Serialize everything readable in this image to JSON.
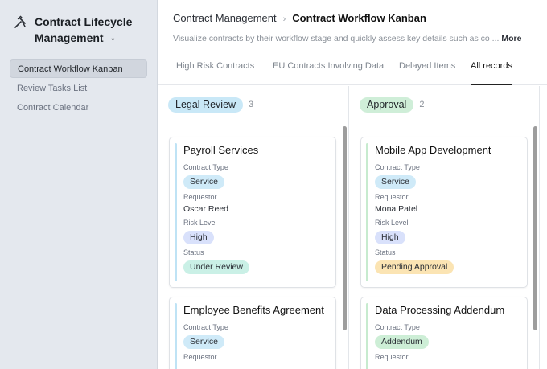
{
  "app": {
    "title_line1": "Contract Lifecycle",
    "title_line2": "Management",
    "icon": "tools-icon"
  },
  "sidebar": {
    "items": [
      {
        "label": "Contract Workflow Kanban",
        "active": true
      },
      {
        "label": "Review Tasks List",
        "active": false
      },
      {
        "label": "Contract Calendar",
        "active": false
      }
    ]
  },
  "breadcrumb": {
    "parent": "Contract Management",
    "separator": "›",
    "current": "Contract Workflow Kanban"
  },
  "description": {
    "text": "Visualize contracts by their workflow stage and quickly assess key details such as co ...",
    "more": "More"
  },
  "tabs": [
    {
      "label": "High Risk Contracts",
      "active": false
    },
    {
      "label": "EU Contracts Involving Data",
      "active": false
    },
    {
      "label": "Delayed Items",
      "active": false
    },
    {
      "label": "All records",
      "active": true
    }
  ],
  "columns": [
    {
      "name": "Legal Review",
      "count": "3",
      "pill_color": "#c9e8f7",
      "bar_color": "#bfe3f5",
      "cards": [
        {
          "title": "Payroll Services",
          "contract_type_label": "Contract Type",
          "contract_type": "Service",
          "requestor_label": "Requestor",
          "requestor": "Oscar Reed",
          "risk_label": "Risk Level",
          "risk": "High",
          "status_label": "Status",
          "status": "Under Review"
        },
        {
          "title": "Employee Benefits Agreement",
          "contract_type_label": "Contract Type",
          "contract_type": "Service",
          "requestor_label": "Requestor"
        }
      ]
    },
    {
      "name": "Approval",
      "count": "2",
      "pill_color": "#cfeed8",
      "bar_color": "#c7ebcf",
      "cards": [
        {
          "title": "Mobile App Development",
          "contract_type_label": "Contract Type",
          "contract_type": "Service",
          "requestor_label": "Requestor",
          "requestor": "Mona Patel",
          "risk_label": "Risk Level",
          "risk": "High",
          "status_label": "Status",
          "status": "Pending Approval"
        },
        {
          "title": "Data Processing Addendum",
          "contract_type_label": "Contract Type",
          "contract_type": "Addendum",
          "requestor_label": "Requestor"
        }
      ]
    }
  ],
  "colors": {
    "service_pill": "#cfeaf8",
    "addendum_pill": "#cdeed6",
    "high_pill": "#d9e1fb",
    "under_review_pill": "#caf0e6",
    "pending_approval_pill": "#fbe4b3"
  }
}
